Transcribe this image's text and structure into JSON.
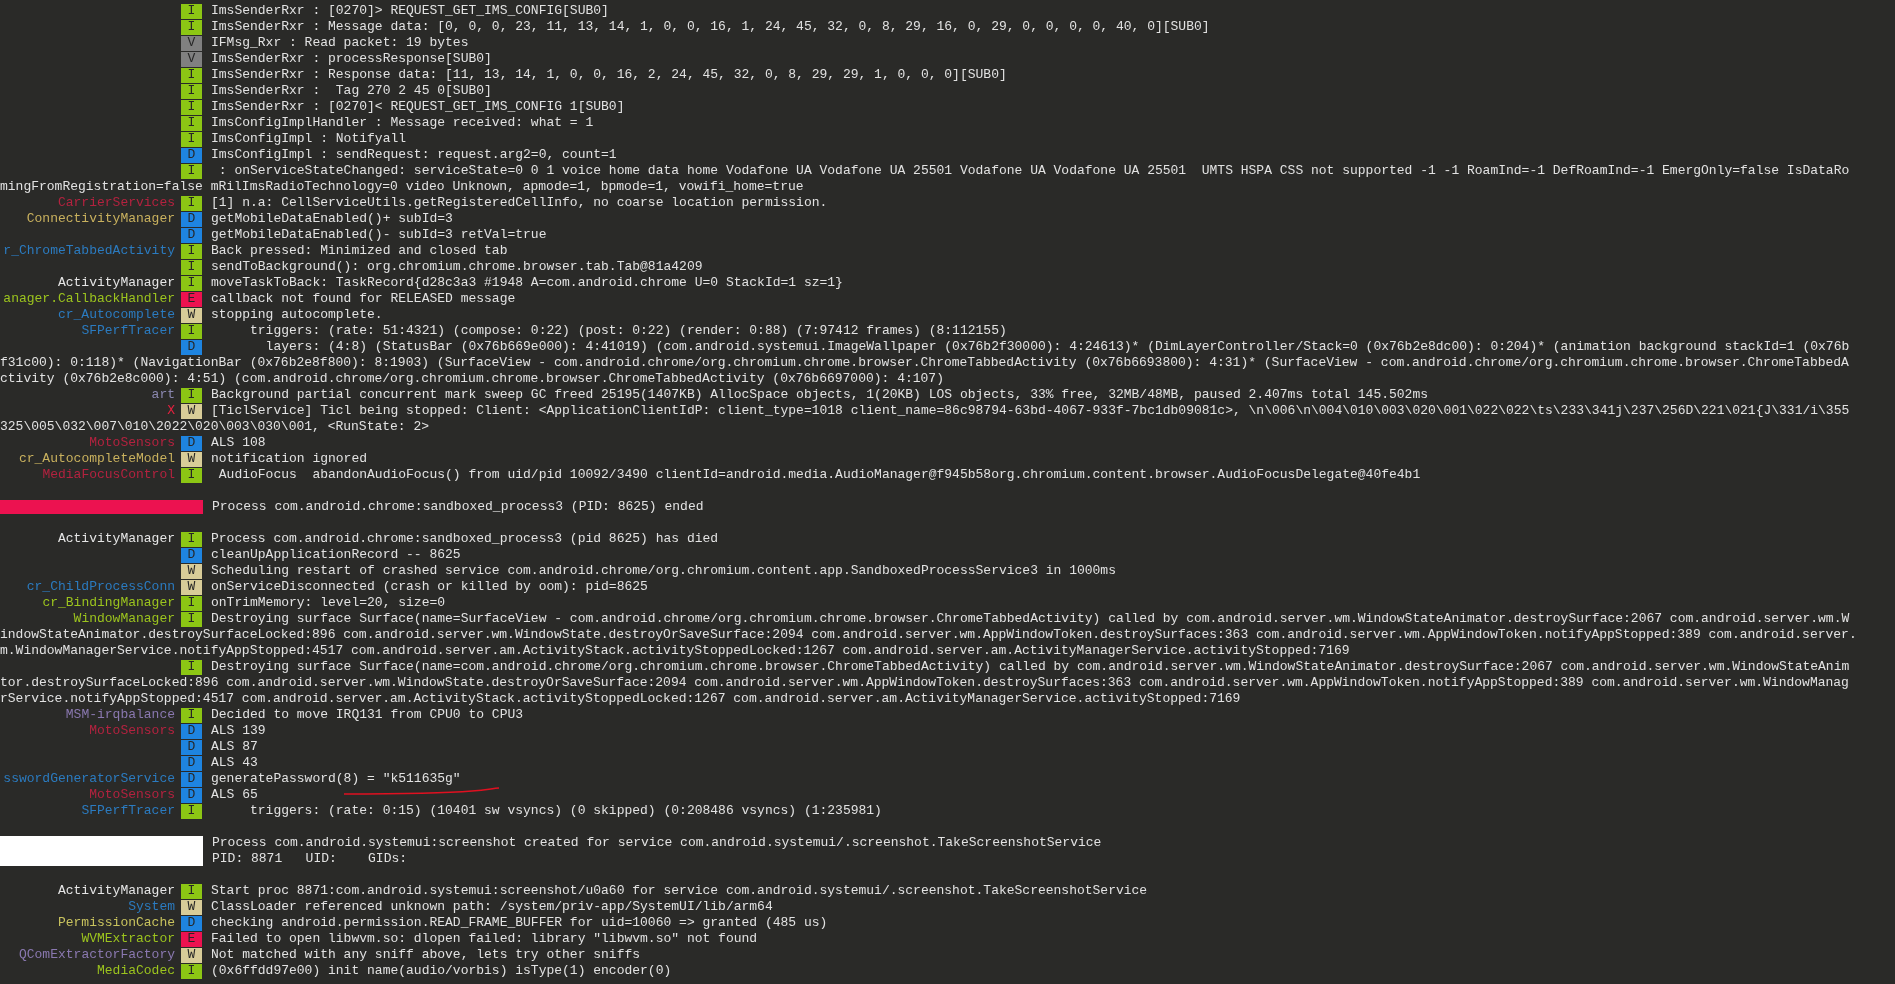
{
  "rows": [
    {
      "kind": "entry",
      "badge": {
        "text": "I",
        "color": "#8cc614"
      },
      "message": "ImsSenderRxr : [0270]> REQUEST_GET_IMS_CONFIG[SUB0]"
    },
    {
      "kind": "entry",
      "badge": {
        "text": "I",
        "color": "#8cc614"
      },
      "message": "ImsSenderRxr : Message data: [0, 0, 0, 23, 11, 13, 14, 1, 0, 0, 16, 1, 24, 45, 32, 0, 8, 29, 16, 0, 29, 0, 0, 0, 0, 40, 0][SUB0]"
    },
    {
      "kind": "entry",
      "badge": {
        "text": "V",
        "color": "#808080"
      },
      "message": "IFMsg_Rxr : Read packet: 19 bytes"
    },
    {
      "kind": "entry",
      "badge": {
        "text": "V",
        "color": "#808080"
      },
      "message": "ImsSenderRxr : processResponse[SUB0]"
    },
    {
      "kind": "entry",
      "badge": {
        "text": "I",
        "color": "#8cc614"
      },
      "message": "ImsSenderRxr : Response data: [11, 13, 14, 1, 0, 0, 16, 2, 24, 45, 32, 0, 8, 29, 29, 1, 0, 0, 0][SUB0]"
    },
    {
      "kind": "entry",
      "badge": {
        "text": "I",
        "color": "#8cc614"
      },
      "message": "ImsSenderRxr :  Tag 270 2 45 0[SUB0]"
    },
    {
      "kind": "entry",
      "badge": {
        "text": "I",
        "color": "#8cc614"
      },
      "message": "ImsSenderRxr : [0270]< REQUEST_GET_IMS_CONFIG 1[SUB0]"
    },
    {
      "kind": "entry",
      "badge": {
        "text": "I",
        "color": "#8cc614"
      },
      "message": "ImsConfigImplHandler : Message received: what = 1"
    },
    {
      "kind": "entry",
      "badge": {
        "text": "I",
        "color": "#8cc614"
      },
      "message": "ImsConfigImpl : Notifyall"
    },
    {
      "kind": "entry",
      "badge": {
        "text": "D",
        "color": "#1e84e0"
      },
      "message": "ImsConfigImpl : sendRequest: request.arg2=0, count=1"
    },
    {
      "kind": "entry",
      "badge": {
        "text": "I",
        "color": "#8cc614"
      },
      "message": " : onServiceStateChanged: serviceState=0 0 1 voice home data home Vodafone UA Vodafone UA 25501 Vodafone UA Vodafone UA 25501  UMTS HSPA CSS not supported -1 -1 RoamInd=-1 DefRoamInd=-1 EmergOnly=false IsDataRo"
    },
    {
      "kind": "wrap",
      "text": "mingFromRegistration=false mRilImsRadioTechnology=0 video Unknown, apmode=1, bpmode=1, vowifi_home=true"
    },
    {
      "kind": "entry",
      "tag": {
        "text": "CarrierServices",
        "color": "#b3223f"
      },
      "badge": {
        "text": "I",
        "color": "#8cc614"
      },
      "message": "[1] n.a: CellServiceUtils.getRegisteredCellInfo, no coarse location permission."
    },
    {
      "kind": "entry",
      "tag": {
        "text": "ConnectivityManager",
        "color": "#c9b15e"
      },
      "badge": {
        "text": "D",
        "color": "#1e84e0"
      },
      "message": "getMobileDataEnabled()+ subId=3"
    },
    {
      "kind": "entry",
      "badge": {
        "text": "D",
        "color": "#1e84e0"
      },
      "message": "getMobileDataEnabled()- subId=3 retVal=true"
    },
    {
      "kind": "entry",
      "tag": {
        "text": "r_ChromeTabbedActivity",
        "color": "#2b7bc0"
      },
      "badge": {
        "text": "I",
        "color": "#8cc614"
      },
      "message": "Back pressed: Minimized and closed tab"
    },
    {
      "kind": "entry",
      "badge": {
        "text": "I",
        "color": "#8cc614"
      },
      "message": "sendToBackground(): org.chromium.chrome.browser.tab.Tab@81a4209"
    },
    {
      "kind": "entry",
      "tag": {
        "text": "ActivityManager",
        "color": "#e6e6e6"
      },
      "badge": {
        "text": "I",
        "color": "#8cc614"
      },
      "message": "moveTaskToBack: TaskRecord{d28c3a3 #1948 A=com.android.chrome U=0 StackId=1 sz=1}"
    },
    {
      "kind": "entry",
      "tag": {
        "text": "anager.CallbackHandler",
        "color": "#9cc41e"
      },
      "badge": {
        "text": "E",
        "color": "#ec1250"
      },
      "message": "callback not found for RELEASED message"
    },
    {
      "kind": "entry",
      "tag": {
        "text": "cr_Autocomplete",
        "color": "#2b7bc0"
      },
      "badge": {
        "text": "W",
        "color": "#d8cc98"
      },
      "message": "stopping autocomplete."
    },
    {
      "kind": "entry",
      "tag": {
        "text": "SFPerfTracer",
        "color": "#2b7bc0"
      },
      "badge": {
        "text": "I",
        "color": "#8cc614"
      },
      "message": "     triggers: (rate: 51:4321) (compose: 0:22) (post: 0:22) (render: 0:88) (7:97412 frames) (8:112155)"
    },
    {
      "kind": "entry",
      "badge": {
        "text": "D",
        "color": "#1e84e0"
      },
      "message": "       layers: (4:8) (StatusBar (0x76b669e000): 4:41019) (com.android.systemui.ImageWallpaper (0x76b2f30000): 4:24613)* (DimLayerController/Stack=0 (0x76b2e8dc00): 0:204)* (animation background stackId=1 (0x76b"
    },
    {
      "kind": "wrap",
      "text": "f31c00): 0:118)* (NavigationBar (0x76b2e8f800): 8:1903) (SurfaceView - com.android.chrome/org.chromium.chrome.browser.ChromeTabbedActivity (0x76b6693800): 4:31)* (SurfaceView - com.android.chrome/org.chromium.chrome.browser.ChromeTabbedA"
    },
    {
      "kind": "wrap",
      "text": "ctivity (0x76b2e8c000): 4:51) (com.android.chrome/org.chromium.chrome.browser.ChromeTabbedActivity (0x76b6697000): 4:107)"
    },
    {
      "kind": "entry",
      "tag": {
        "text": "art",
        "color": "#8b88b0"
      },
      "badge": {
        "text": "I",
        "color": "#8cc614"
      },
      "message": "Background partial concurrent mark sweep GC freed 25195(1407KB) AllocSpace objects, 1(20KB) LOS objects, 33% free, 32MB/48MB, paused 2.407ms total 145.502ms"
    },
    {
      "kind": "entry",
      "tag": {
        "text": "X",
        "color": "#e3213f"
      },
      "badge": {
        "text": "W",
        "color": "#d8cc98"
      },
      "message": "[TiclService] Ticl being stopped: Client: <ApplicationClientIdP: client_type=1018 client_name=86c98794-63bd-4067-933f-7bc1db09081c>, \\n\\006\\n\\004\\010\\003\\020\\001\\022\\022\\ts\\233\\341j\\237\\256D\\221\\021{J\\331/i\\355"
    },
    {
      "kind": "wrap",
      "text": "325\\005\\032\\007\\010\\2022\\020\\003\\030\\001, <RunState: 2>"
    },
    {
      "kind": "entry",
      "tag": {
        "text": "MotoSensors",
        "color": "#b3223f"
      },
      "badge": {
        "text": "D",
        "color": "#1e84e0"
      },
      "message": "ALS 108"
    },
    {
      "kind": "entry",
      "tag": {
        "text": "cr_AutocompleteModel",
        "color": "#c9b15e"
      },
      "badge": {
        "text": "W",
        "color": "#d8cc98"
      },
      "message": "notification ignored"
    },
    {
      "kind": "entry",
      "tag": {
        "text": "MediaFocusControl",
        "color": "#b3223f"
      },
      "badge": {
        "text": "I",
        "color": "#8cc614"
      },
      "message": " AudioFocus  abandonAudioFocus() from uid/pid 10092/3490 clientId=android.media.AudioManager@f945b58org.chromium.content.browser.AudioFocusDelegate@40fe4b1"
    },
    {
      "kind": "blank"
    },
    {
      "kind": "banner",
      "color": "#ec1250",
      "lines": [
        "Process com.android.chrome:sandboxed_process3 (PID: 8625) ended"
      ]
    },
    {
      "kind": "blank"
    },
    {
      "kind": "entry",
      "tag": {
        "text": "ActivityManager",
        "color": "#e6e6e6"
      },
      "badge": {
        "text": "I",
        "color": "#8cc614"
      },
      "message": "Process com.android.chrome:sandboxed_process3 (pid 8625) has died"
    },
    {
      "kind": "entry",
      "badge": {
        "text": "D",
        "color": "#1e84e0"
      },
      "message": "cleanUpApplicationRecord -- 8625"
    },
    {
      "kind": "entry",
      "badge": {
        "text": "W",
        "color": "#d8cc98"
      },
      "message": "Scheduling restart of crashed service com.android.chrome/org.chromium.content.app.SandboxedProcessService3 in 1000ms"
    },
    {
      "kind": "entry",
      "tag": {
        "text": "cr_ChildProcessConn",
        "color": "#2b7bc0"
      },
      "badge": {
        "text": "W",
        "color": "#d8cc98"
      },
      "message": "onServiceDisconnected (crash or killed by oom): pid=8625"
    },
    {
      "kind": "entry",
      "tag": {
        "text": "cr_BindingManager",
        "color": "#9cc41e"
      },
      "badge": {
        "text": "I",
        "color": "#8cc614"
      },
      "message": "onTrimMemory: level=20, size=0"
    },
    {
      "kind": "entry",
      "tag": {
        "text": "WindowManager",
        "color": "#9cc41e"
      },
      "badge": {
        "text": "I",
        "color": "#8cc614"
      },
      "message": "Destroying surface Surface(name=SurfaceView - com.android.chrome/org.chromium.chrome.browser.ChromeTabbedActivity) called by com.android.server.wm.WindowStateAnimator.destroySurface:2067 com.android.server.wm.W"
    },
    {
      "kind": "wrap",
      "text": "indowStateAnimator.destroySurfaceLocked:896 com.android.server.wm.WindowState.destroyOrSaveSurface:2094 com.android.server.wm.AppWindowToken.destroySurfaces:363 com.android.server.wm.AppWindowToken.notifyAppStopped:389 com.android.server."
    },
    {
      "kind": "wrap",
      "text": "m.WindowManagerService.notifyAppStopped:4517 com.android.server.am.ActivityStack.activityStoppedLocked:1267 com.android.server.am.ActivityManagerService.activityStopped:7169"
    },
    {
      "kind": "entry",
      "badge": {
        "text": "I",
        "color": "#8cc614"
      },
      "message": "Destroying surface Surface(name=com.android.chrome/org.chromium.chrome.browser.ChromeTabbedActivity) called by com.android.server.wm.WindowStateAnimator.destroySurface:2067 com.android.server.wm.WindowStateAnim"
    },
    {
      "kind": "wrap",
      "text": "tor.destroySurfaceLocked:896 com.android.server.wm.WindowState.destroyOrSaveSurface:2094 com.android.server.wm.AppWindowToken.destroySurfaces:363 com.android.server.wm.AppWindowToken.notifyAppStopped:389 com.android.server.wm.WindowManag"
    },
    {
      "kind": "wrap",
      "text": "rService.notifyAppStopped:4517 com.android.server.am.ActivityStack.activityStoppedLocked:1267 com.android.server.am.ActivityManagerService.activityStopped:7169"
    },
    {
      "kind": "entry",
      "tag": {
        "text": "MSM-irqbalance",
        "color": "#8a78b0"
      },
      "badge": {
        "text": "I",
        "color": "#8cc614"
      },
      "message": "Decided to move IRQ131 from CPU0 to CPU3"
    },
    {
      "kind": "entry",
      "tag": {
        "text": "MotoSensors",
        "color": "#b3223f"
      },
      "badge": {
        "text": "D",
        "color": "#1e84e0"
      },
      "message": "ALS 139"
    },
    {
      "kind": "entry",
      "badge": {
        "text": "D",
        "color": "#1e84e0"
      },
      "message": "ALS 87"
    },
    {
      "kind": "entry",
      "badge": {
        "text": "D",
        "color": "#1e84e0"
      },
      "message": "ALS 43"
    },
    {
      "kind": "entry",
      "tag": {
        "text": "sswordGeneratorService",
        "color": "#2b7bc0"
      },
      "badge": {
        "text": "D",
        "color": "#1e84e0"
      },
      "message": "generatePassword(8) = \"k511635g\"",
      "annotation": {
        "kind": "underline"
      }
    },
    {
      "kind": "entry",
      "tag": {
        "text": "MotoSensors",
        "color": "#b3223f"
      },
      "badge": {
        "text": "D",
        "color": "#1e84e0"
      },
      "message": "ALS 65"
    },
    {
      "kind": "entry",
      "tag": {
        "text": "SFPerfTracer",
        "color": "#2b7bc0"
      },
      "badge": {
        "text": "I",
        "color": "#8cc614"
      },
      "message": "     triggers: (rate: 0:15) (10401 sw vsyncs) (0 skipped) (0:208486 vsyncs) (1:235981)"
    },
    {
      "kind": "blank"
    },
    {
      "kind": "banner",
      "color": "#ffffff",
      "lines": [
        "Process com.android.systemui:screenshot created for service com.android.systemui/.screenshot.TakeScreenshotService",
        "PID: 8871   UID:    GIDs:"
      ]
    },
    {
      "kind": "blank"
    },
    {
      "kind": "entry",
      "tag": {
        "text": "ActivityManager",
        "color": "#e6e6e6"
      },
      "badge": {
        "text": "I",
        "color": "#8cc614"
      },
      "message": "Start proc 8871:com.android.systemui:screenshot/u0a60 for service com.android.systemui/.screenshot.TakeScreenshotService"
    },
    {
      "kind": "entry",
      "tag": {
        "text": "System",
        "color": "#2b7bc0"
      },
      "badge": {
        "text": "W",
        "color": "#d8cc98"
      },
      "message": "ClassLoader referenced unknown path: /system/priv-app/SystemUI/lib/arm64"
    },
    {
      "kind": "entry",
      "tag": {
        "text": "PermissionCache",
        "color": "#c9c35e"
      },
      "badge": {
        "text": "D",
        "color": "#1e84e0"
      },
      "message": "checking android.permission.READ_FRAME_BUFFER for uid=10060 => granted (485 us)"
    },
    {
      "kind": "entry",
      "tag": {
        "text": "WVMExtractor",
        "color": "#9cc41e"
      },
      "badge": {
        "text": "E",
        "color": "#ec1250"
      },
      "message": "Failed to open libwvm.so: dlopen failed: library \"libwvm.so\" not found"
    },
    {
      "kind": "entry",
      "tag": {
        "text": "QComExtractorFactory",
        "color": "#8a78b0"
      },
      "badge": {
        "text": "W",
        "color": "#d8cc98"
      },
      "message": "Not matched with any sniff above, lets try other sniffs"
    },
    {
      "kind": "entry",
      "tag": {
        "text": "MediaCodec",
        "color": "#9cc41e"
      },
      "badge": {
        "text": "I",
        "color": "#8cc614"
      },
      "message": "(0x6ffdd97e00) init name(audio/vorbis) isType(1) encoder(0)"
    }
  ]
}
